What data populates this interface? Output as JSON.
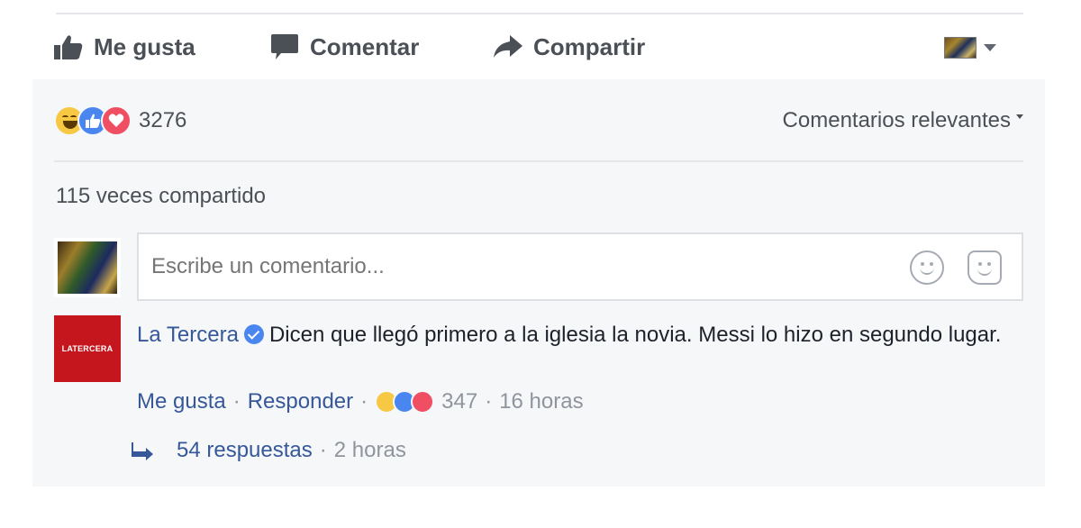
{
  "actions": {
    "like_label": "Me gusta",
    "comment_label": "Comentar",
    "share_label": "Compartir"
  },
  "reactions": {
    "types": [
      "haha",
      "like",
      "love"
    ],
    "count": "3276"
  },
  "sort": {
    "label": "Comentarios relevantes"
  },
  "shares": {
    "label": "115 veces compartido"
  },
  "composer": {
    "placeholder": "Escribe un comentario..."
  },
  "comment": {
    "avatar_text": "LATERCERA",
    "author": "La Tercera",
    "verified": true,
    "text": "Dicen que llegó primero a la iglesia la novia. Messi lo hizo en segundo lugar.",
    "like_label": "Me gusta",
    "reply_label": "Responder",
    "reaction_count": "347",
    "time": "16 horas",
    "replies_label": "54 respuestas",
    "replies_time": "2 horas"
  },
  "colors": {
    "link": "#365899",
    "meta": "#90949c",
    "panel_bg": "#f6f7f9",
    "haha": "#f7c843",
    "like": "#4a86f0",
    "love": "#ef4e63",
    "brand_red": "#c4161c"
  }
}
